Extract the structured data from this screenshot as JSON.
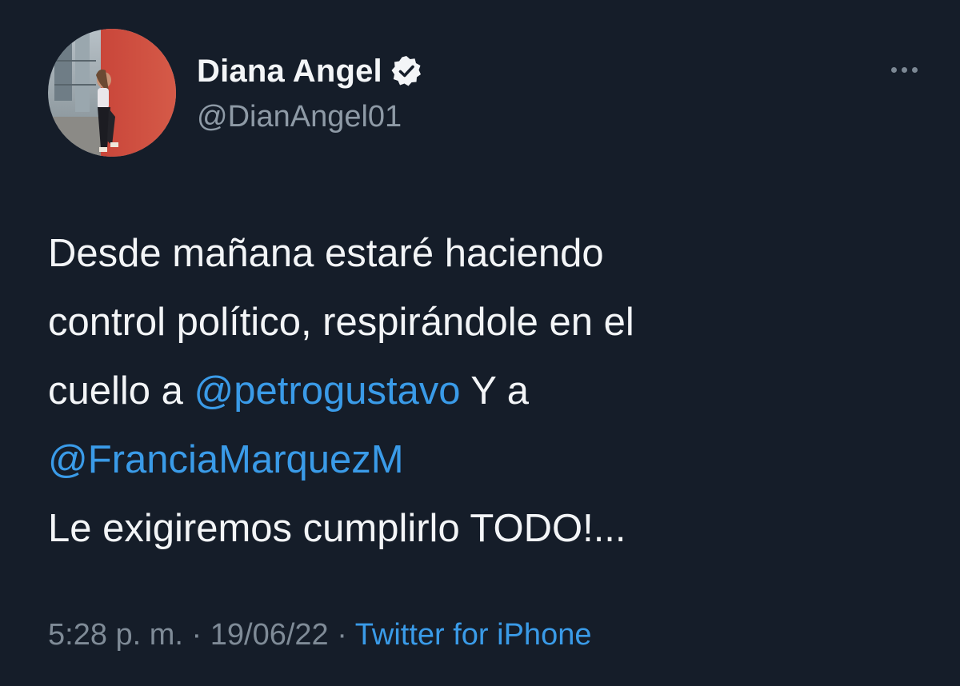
{
  "author": {
    "display_name": "Diana Angel",
    "handle": "@DianAngel01",
    "verified": true
  },
  "tweet": {
    "line1": "Desde mañana estaré haciendo",
    "line2": "control político, respirándole en el",
    "line3_prefix": "cuello a ",
    "mention1": "@petrogustavo",
    "line3_suffix": " Y a",
    "mention2": "@FranciaMarquezM",
    "line5": "Le exigiremos cumplirlo TODO!..."
  },
  "meta": {
    "time": "5:28 p. m.",
    "separator": "·",
    "date": "19/06/22",
    "source": "Twitter for iPhone"
  },
  "icons": {
    "verified": "verified-badge-icon",
    "more": "more-options-icon"
  },
  "colors": {
    "background": "#151d29",
    "text": "#f3f5f7",
    "secondary": "#8e9aa6",
    "link": "#3a9be8"
  }
}
